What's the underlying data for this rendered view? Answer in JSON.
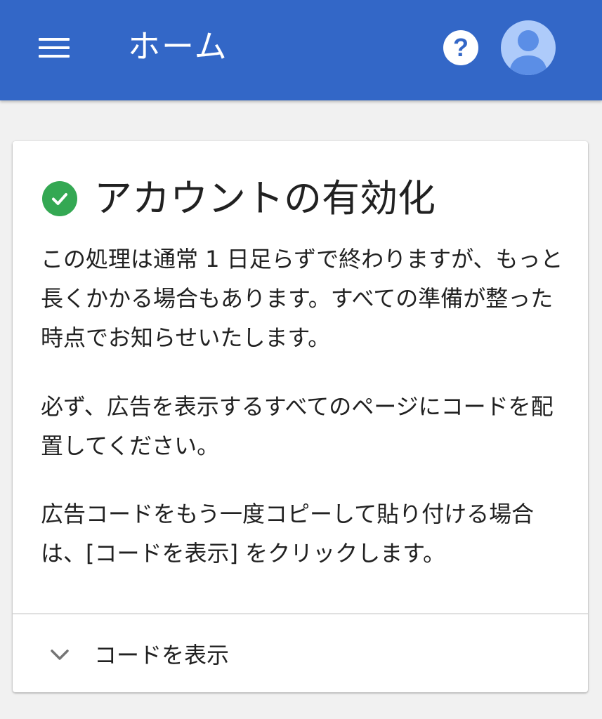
{
  "appbar": {
    "title": "ホーム",
    "menu_icon": "hamburger-menu-icon",
    "help_icon": "help-icon",
    "avatar_icon": "account-avatar-icon",
    "help_glyph": "?"
  },
  "card": {
    "status_icon": "check-circle-icon",
    "heading": "アカウントの有効化",
    "paragraphs": [
      "この処理は通常 1 日足らずで終わりますが、もっと長くかかる場合もあります。すべての準備が整った時点でお知らせいたします。",
      "必ず、広告を表示するすべてのページにコードを配置してください。",
      "広告コードをもう一度コピーして貼り付ける場合は、[コードを表示] をクリックします。"
    ],
    "expand": {
      "label": "コードを表示",
      "icon": "chevron-down-icon"
    }
  },
  "colors": {
    "appbar": "#3367c7",
    "check": "#34a853",
    "avatar_bg": "#aecbfa",
    "avatar_fg": "#5b8ee6",
    "background": "#f1f1f1"
  }
}
